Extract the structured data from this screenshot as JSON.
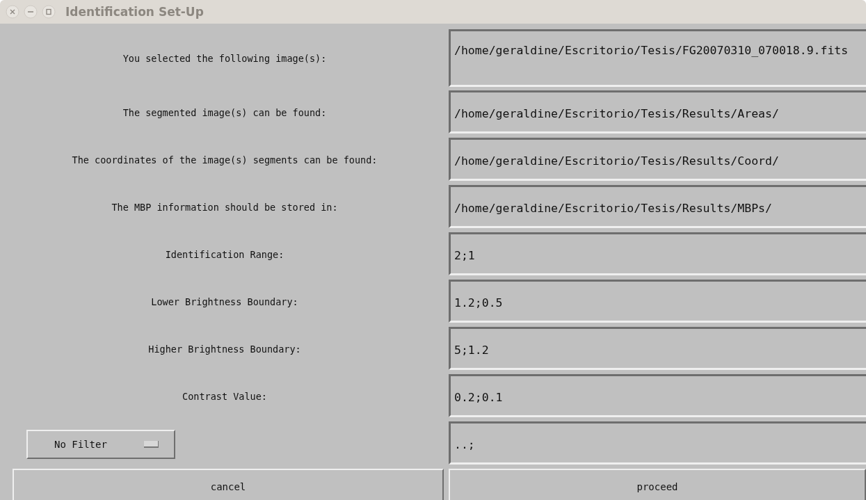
{
  "window": {
    "title": "Identification Set-Up"
  },
  "rows": [
    {
      "label": "You selected the following image(s):",
      "value": "/home/geraldine/Escritorio/Tesis/FG20070310_070018.9.fits",
      "tall": true
    },
    {
      "label": "The segmented image(s) can be found:",
      "value": "/home/geraldine/Escritorio/Tesis/Results/Areas/",
      "tall": false
    },
    {
      "label": "The coordinates of the image(s) segments can be found:",
      "value": "/home/geraldine/Escritorio/Tesis/Results/Coord/",
      "tall": false
    },
    {
      "label": "The MBP information should be stored in:",
      "value": "/home/geraldine/Escritorio/Tesis/Results/MBPs/",
      "tall": false
    },
    {
      "label": "Identification Range:",
      "value": "2;1",
      "tall": false
    },
    {
      "label": "Lower Brightness Boundary:",
      "value": "1.2;0.5",
      "tall": false
    },
    {
      "label": "Higher Brightness Boundary:",
      "value": "5;1.2",
      "tall": false
    },
    {
      "label": "Contrast Value:",
      "value": "0.2;0.1",
      "tall": false
    }
  ],
  "filter": {
    "option": "No Filter",
    "value": "..;"
  },
  "buttons": [
    "cancel",
    "proceed"
  ]
}
